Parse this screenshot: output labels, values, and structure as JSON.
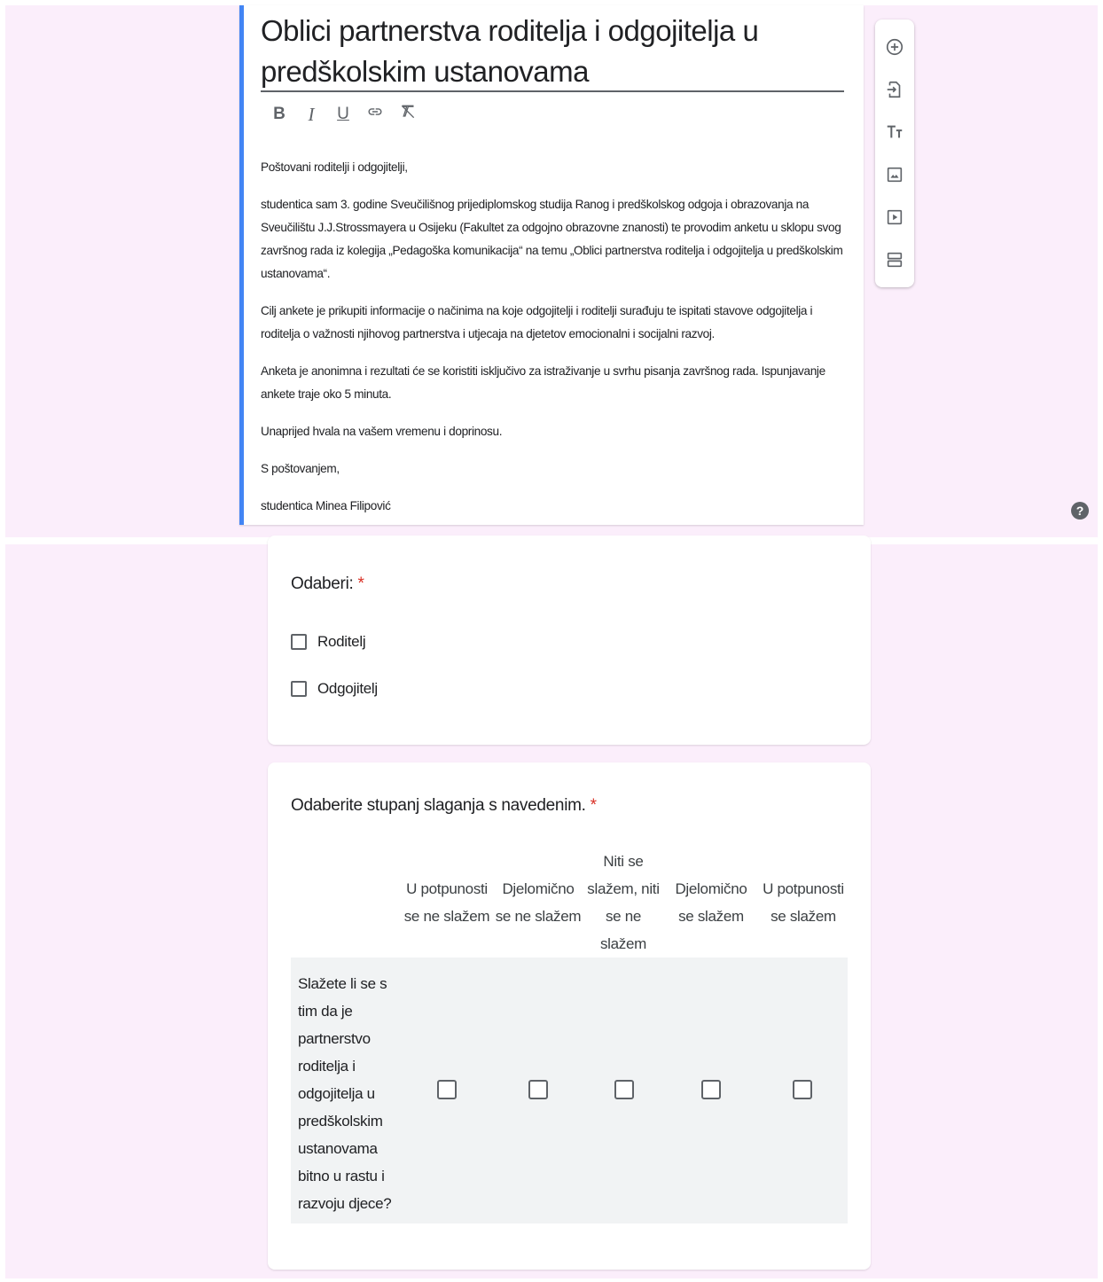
{
  "form": {
    "title": "Oblici partnerstva roditelja i odgojitelja u predškolskim ustanovama",
    "format_toolbar": {
      "bold": "B",
      "italic": "I",
      "underline": "U",
      "link_icon": "link-icon",
      "clear_format_icon": "clear-format-icon"
    },
    "description": [
      "Poštovani roditelji i odgojitelji,",
      "studentica sam 3. godine Sveučilišnog prijediplomskog studija Ranog i predškolskog odgoja i obrazovanja na Sveučilištu J.J.Strossmayera u Osijeku (Fakultet za odgojno obrazovne znanosti) te provodim anketu u sklopu svog završnog rada iz kolegija „Pedagoška komunikacija“ na temu „Oblici partnerstva roditelja i odgojitelja u predškolskim ustanovama“.",
      "Cilj ankete je prikupiti informacije o načinima na koje odgojitelji i roditelji surađuju te ispitati stavove odgojitelja i roditelja o važnosti njihovog partnerstva i utjecaja na djetetov emocionalni i socijalni razvoj.",
      "Anketa je anonimna i rezultati će se koristiti isključivo za istraživanje u svrhu pisanja završnog rada. Ispunjavanje ankete traje oko 5 minuta.",
      "Unaprijed hvala na vašem vremenu i doprinosu.",
      "S poštovanjem,",
      "studentica Minea Filipović"
    ]
  },
  "side_toolbar": {
    "items": [
      "add-question-icon",
      "import-questions-icon",
      "add-title-icon",
      "add-image-icon",
      "add-video-icon",
      "add-section-icon"
    ]
  },
  "help": {
    "icon": "help-icon",
    "label": "?"
  },
  "question1": {
    "title": "Odaberi:",
    "required_mark": "*",
    "options": [
      "Roditelj",
      "Odgojitelj"
    ]
  },
  "question2": {
    "title": "Odaberite stupanj slaganja s navedenim.",
    "required_mark": "*",
    "columns": [
      [
        "U potpunosti",
        "se ne slažem"
      ],
      [
        "Djelomično",
        "se ne slažem"
      ],
      [
        "Niti se",
        "slažem, niti",
        "se ne",
        "slažem"
      ],
      [
        "Djelomično",
        "se slažem"
      ],
      [
        "U potpunosti",
        "se slažem"
      ]
    ],
    "rows": [
      {
        "label_lines": [
          "Slažete li se s",
          "tim da je",
          "partnerstvo",
          "roditelja i",
          "odgojitelja u",
          "predškolskim",
          "ustanovama",
          "bitno u rastu i",
          "razvoju djece?"
        ]
      }
    ]
  },
  "colors": {
    "background": "#fbeefb",
    "accent": "#4285f4",
    "required": "#d93025",
    "icon": "#5f6368"
  }
}
